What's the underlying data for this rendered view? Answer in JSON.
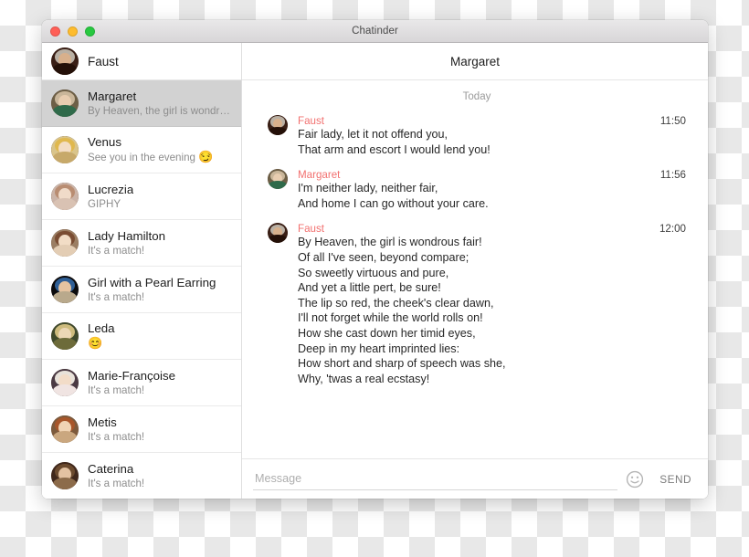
{
  "window": {
    "title": "Chatinder",
    "traffic_lights": [
      "close",
      "minimize",
      "zoom"
    ]
  },
  "sidebar": {
    "me": {
      "name": "Faust",
      "avatar": "faust"
    },
    "conversations": [
      {
        "name": "Margaret",
        "preview": "By Heaven, the girl is wondro…",
        "emoji": "",
        "selected": true,
        "avatar": "margaret"
      },
      {
        "name": "Venus",
        "preview": "See you in the evening",
        "emoji": "😏",
        "selected": false,
        "avatar": "venus"
      },
      {
        "name": "Lucrezia",
        "preview": "GIPHY",
        "emoji": "",
        "selected": false,
        "avatar": "lucrezia"
      },
      {
        "name": "Lady Hamilton",
        "preview": "It's a match!",
        "emoji": "",
        "selected": false,
        "avatar": "hamilton"
      },
      {
        "name": "Girl with a Pearl Earring",
        "preview": "It's a match!",
        "emoji": "",
        "selected": false,
        "avatar": "pearl"
      },
      {
        "name": "Leda",
        "preview": "",
        "emoji": "😊",
        "selected": false,
        "avatar": "leda"
      },
      {
        "name": "Marie-Françoise",
        "preview": "It's a match!",
        "emoji": "",
        "selected": false,
        "avatar": "marie"
      },
      {
        "name": "Metis",
        "preview": "It's a match!",
        "emoji": "",
        "selected": false,
        "avatar": "metis"
      },
      {
        "name": "Caterina",
        "preview": "It's a match!",
        "emoji": "",
        "selected": false,
        "avatar": "caterina"
      }
    ]
  },
  "chat": {
    "header_title": "Margaret",
    "day_separator": "Today",
    "messages": [
      {
        "sender": "Faust",
        "time": "11:50",
        "avatar": "faust",
        "lines": [
          "Fair lady, let it not offend you,",
          "That arm and escort I would lend you!"
        ]
      },
      {
        "sender": "Margaret",
        "time": "11:56",
        "avatar": "margaret",
        "lines": [
          "I'm neither lady, neither fair,",
          "And home I can go without your care."
        ]
      },
      {
        "sender": "Faust",
        "time": "12:00",
        "avatar": "faust",
        "lines": [
          "By Heaven, the girl is wondrous fair!",
          "Of all I've seen, beyond compare;",
          "So sweetly virtuous and pure,",
          "And yet a little pert, be sure!",
          "The lip so red, the cheek's clear dawn,",
          "I'll not forget while the world rolls on!",
          "How she cast down her timid eyes,",
          "Deep in my heart imprinted lies:",
          "How short and sharp of speech was she,",
          "Why, 'twas a real ecstasy!"
        ]
      }
    ]
  },
  "composer": {
    "placeholder": "Message",
    "value": "",
    "emoji_icon": "smiley-face-icon",
    "send_label": "SEND"
  },
  "colors": {
    "sender_name": "#f2706f",
    "selected_row": "#d2d2d2",
    "titlebar_text": "#4a4a4a",
    "preview_text": "#8d8d8d",
    "send_text": "#7b7b7b"
  },
  "avatar_palettes": {
    "faust": {
      "bg": "#3a1f16",
      "hair": "#b9b0a4",
      "face": "#d8b08c",
      "body": "#241008"
    },
    "margaret": {
      "bg": "#6d5f46",
      "hair": "#c9b69a",
      "face": "#e8cdb0",
      "body": "#2f6a4a"
    },
    "venus": {
      "bg": "#d9c48a",
      "hair": "#e0b84e",
      "face": "#f3ddc4",
      "body": "#c7a96a"
    },
    "lucrezia": {
      "bg": "#cbb4a8",
      "hair": "#b98d72",
      "face": "#f0dbc9",
      "body": "#d9c2b3"
    },
    "hamilton": {
      "bg": "#9b7e63",
      "hair": "#7a4d33",
      "face": "#f2ddc6",
      "body": "#e3cdb4"
    },
    "pearl": {
      "bg": "#0b0b0d",
      "hair": "#2f5f96",
      "face": "#e5c3a0",
      "body": "#b9a98c"
    },
    "leda": {
      "bg": "#3f4a2c",
      "hair": "#cdbb7d",
      "face": "#ecd7b6",
      "body": "#6d6b3a"
    },
    "marie": {
      "bg": "#4b3a44",
      "hair": "#e8e2da",
      "face": "#f2dcc8",
      "body": "#f0e4e2"
    },
    "metis": {
      "bg": "#7d5a3c",
      "hair": "#a8562a",
      "face": "#f0d4b4",
      "body": "#caa77f"
    },
    "caterina": {
      "bg": "#40281c",
      "hair": "#6b4a2e",
      "face": "#e3c2a2",
      "body": "#8c6b4a"
    }
  }
}
